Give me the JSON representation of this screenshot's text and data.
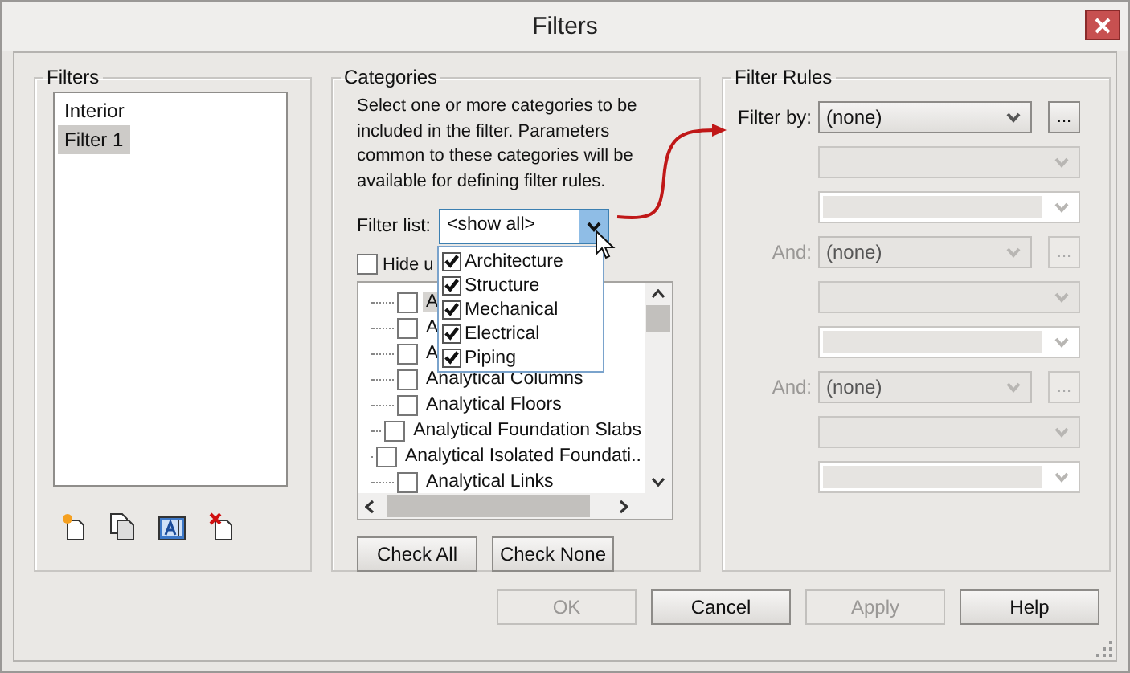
{
  "window": {
    "title": "Filters"
  },
  "filters_panel": {
    "title": "Filters",
    "items": [
      {
        "label": "Interior",
        "selected": false
      },
      {
        "label": "Filter 1",
        "selected": true
      }
    ]
  },
  "categories_panel": {
    "title": "Categories",
    "description": "Select one or more categories to be\nincluded in the filter.  Parameters\ncommon to these categories will be\navailable for defining filter rules.",
    "filter_list": {
      "label": "Filter list:",
      "value": "<show all>",
      "expanded": true,
      "options": [
        {
          "label": "Architecture",
          "checked": true
        },
        {
          "label": "Structure",
          "checked": true
        },
        {
          "label": "Mechanical",
          "checked": true
        },
        {
          "label": "Electrical",
          "checked": true
        },
        {
          "label": "Piping",
          "checked": true
        }
      ]
    },
    "hide_checkbox": {
      "label": "Hide u",
      "checked": false
    },
    "tree": [
      {
        "label": "A",
        "checked": false,
        "selected": true
      },
      {
        "label": "A",
        "checked": false,
        "selected": false
      },
      {
        "label": "A",
        "checked": false,
        "selected": false
      },
      {
        "label": "Analytical Columns",
        "checked": false,
        "selected": false
      },
      {
        "label": "Analytical Floors",
        "checked": false,
        "selected": false
      },
      {
        "label": "Analytical Foundation Slabs",
        "checked": false,
        "selected": false
      },
      {
        "label": "Analytical Isolated Foundati..",
        "checked": false,
        "selected": false
      },
      {
        "label": "Analytical Links",
        "checked": false,
        "selected": false
      }
    ],
    "buttons": [
      "Check All",
      "Check None"
    ]
  },
  "filter_rules": {
    "title": "Filter Rules",
    "rules": [
      {
        "label": "Filter by:",
        "value": "(none)",
        "browse": "...",
        "disabled": false
      },
      {
        "label": "And:",
        "value": "(none)",
        "browse": "...",
        "disabled": true
      },
      {
        "label": "And:",
        "value": "(none)",
        "browse": "...",
        "disabled": true
      }
    ]
  },
  "buttons": [
    {
      "label": "OK",
      "disabled": true
    },
    {
      "label": "Cancel",
      "disabled": false
    },
    {
      "label": "Apply",
      "disabled": true
    },
    {
      "label": "Help",
      "disabled": false
    }
  ]
}
